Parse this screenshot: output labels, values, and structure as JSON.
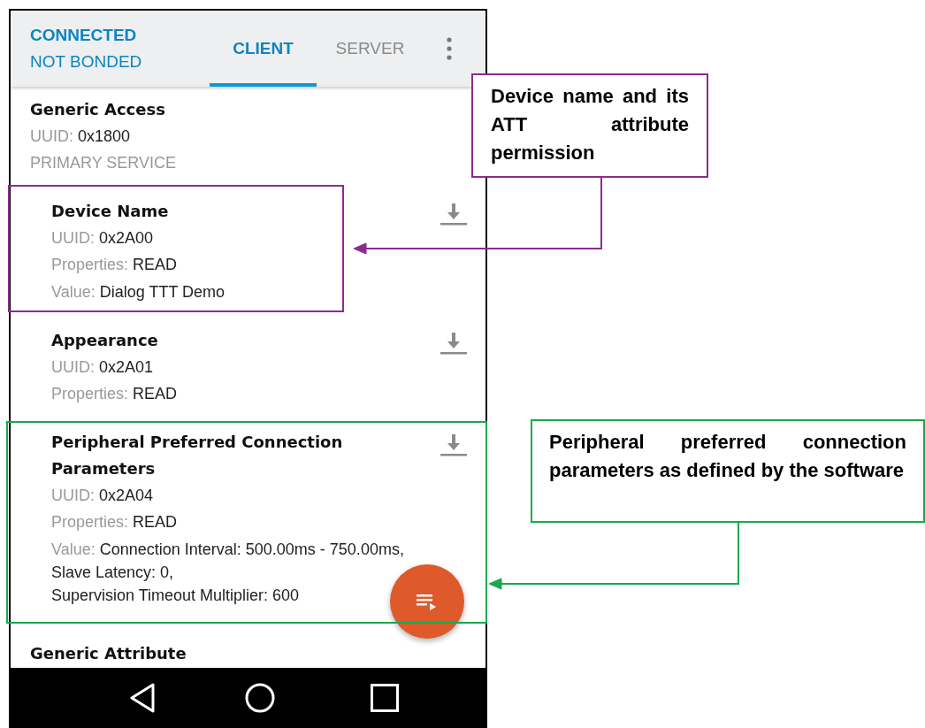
{
  "status": {
    "connection": "CONNECTED",
    "bonding": "NOT BONDED"
  },
  "tabs": [
    {
      "label": "CLIENT",
      "selected": true
    },
    {
      "label": "SERVER",
      "selected": false
    }
  ],
  "services": [
    {
      "name": "Generic Access",
      "uuid_label": "UUID:",
      "uuid": "0x1800",
      "type": "PRIMARY SERVICE",
      "characteristics": [
        {
          "name": "Device Name",
          "uuid_label": "UUID:",
          "uuid": "0x2A00",
          "properties_label": "Properties:",
          "properties": "READ",
          "value_label": "Value:",
          "value": [
            "Dialog TTT Demo"
          ]
        },
        {
          "name": "Appearance",
          "uuid_label": "UUID:",
          "uuid": "0x2A01",
          "properties_label": "Properties:",
          "properties": "READ"
        },
        {
          "name": "Peripheral Preferred Connection Parameters",
          "uuid_label": "UUID:",
          "uuid": "0x2A04",
          "properties_label": "Properties:",
          "properties": "READ",
          "value_label": "Value:",
          "value": [
            "Connection Interval: 500.00ms - 750.00ms,",
            "Slave Latency: 0,",
            "Supervision Timeout Multiplier: 600"
          ]
        }
      ]
    },
    {
      "name": "Generic Attribute"
    }
  ],
  "annotations": [
    {
      "text": "Device name and its ATT attribute permission",
      "color": "#8e2a8e"
    },
    {
      "text": "Peripheral preferred connection parameters as defined by the software",
      "color": "#19a94f"
    }
  ]
}
